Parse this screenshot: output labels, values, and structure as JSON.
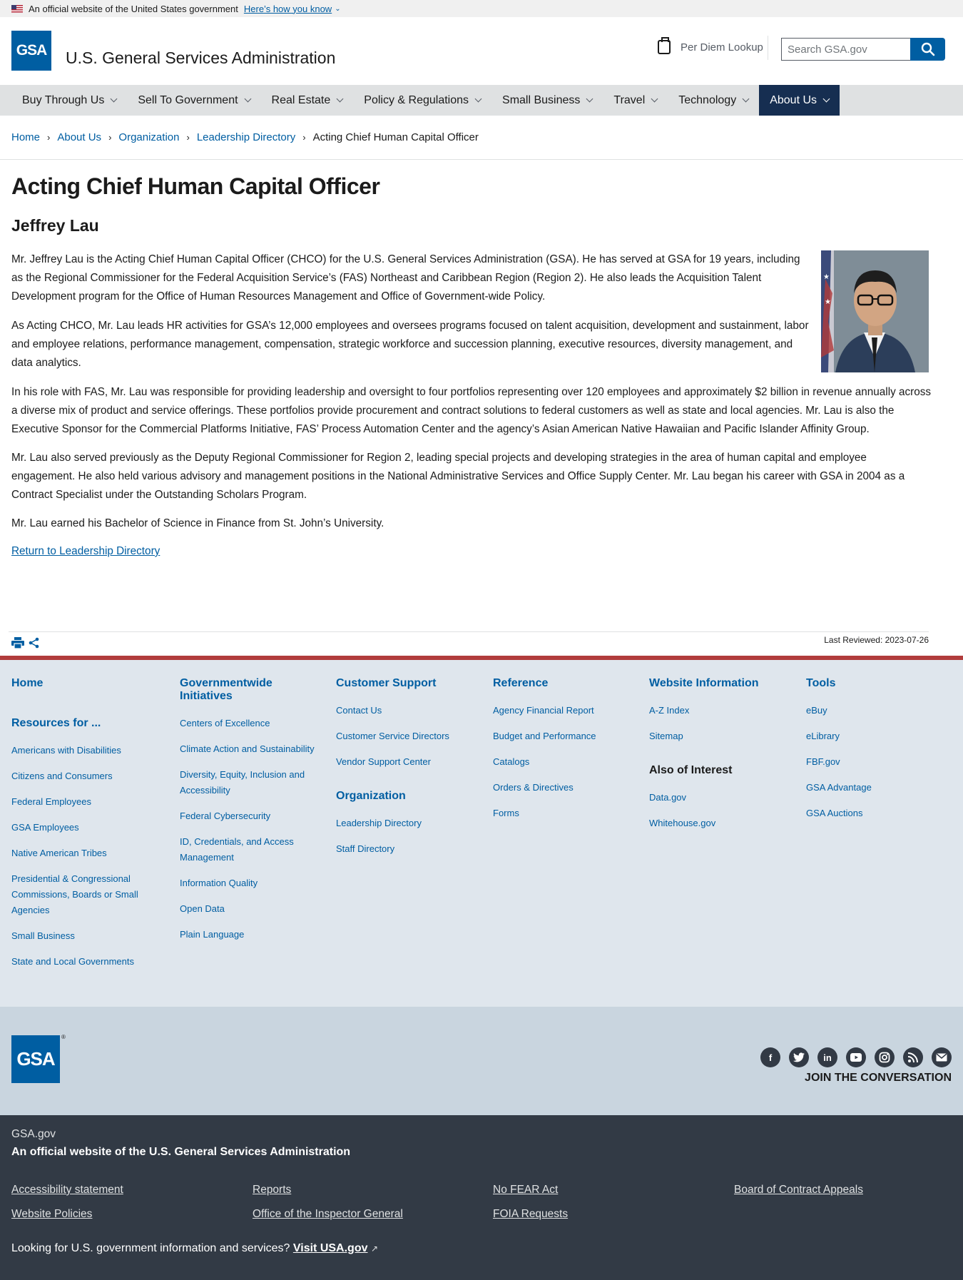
{
  "banner": {
    "text": "An official website of the United States government",
    "how_link": "Here’s how you know"
  },
  "header": {
    "logo_text": "GSA",
    "site_title": "U.S. General Services Administration",
    "per_diem": "Per Diem Lookup",
    "search_placeholder": "Search GSA.gov"
  },
  "nav": {
    "items": [
      {
        "label": "Buy Through Us"
      },
      {
        "label": "Sell To Government"
      },
      {
        "label": "Real Estate"
      },
      {
        "label": "Policy & Regulations"
      },
      {
        "label": "Small Business"
      },
      {
        "label": "Travel"
      },
      {
        "label": "Technology"
      },
      {
        "label": "About Us"
      }
    ],
    "active_color": "#162e51"
  },
  "breadcrumb": {
    "items": [
      "Home",
      "About Us",
      "Organization",
      "Leadership Directory"
    ],
    "current": "Acting Chief Human Capital Officer"
  },
  "main": {
    "title": "Acting Chief Human Capital Officer",
    "name": "Jeffrey Lau",
    "paragraphs": [
      "Mr. Jeffrey Lau is the Acting Chief Human Capital Officer (CHCO) for the U.S. General Services Administration (GSA). He has served at GSA for 19 years, including as the Regional Commissioner for the Federal Acquisition Service’s (FAS) Northeast and Caribbean Region (Region 2). He also leads the Acquisition Talent Development program for the Office of Human Resources Management and Office of Government-wide Policy.",
      "As Acting CHCO, Mr. Lau leads HR activities for GSA’s 12,000 employees and oversees programs focused on talent acquisition, development and sustainment, labor and employee relations, performance management, compensation, strategic workforce and succession planning, executive resources, diversity management, and data analytics.",
      "In his role with FAS, Mr. Lau was responsible for providing leadership and oversight to four portfolios representing over 120 employees and approximately $2 billion in revenue annually across a diverse mix of product and service offerings. These portfolios provide procurement and contract solutions to federal customers as well as state and local agencies. Mr. Lau is also the Executive Sponsor for the Commercial Platforms Initiative, FAS’ Process Automation Center and the agency’s Asian American Native Hawaiian and Pacific Islander Affinity Group.",
      "Mr. Lau also served previously as the Deputy Regional Commissioner for Region 2, leading special projects and developing strategies in the area of human capital and employee engagement. He also held various advisory and management positions in the National Administrative Services and Office Supply Center. Mr. Lau began his career with GSA in 2004 as a Contract Specialist under the Outstanding Scholars Program.",
      "Mr. Lau earned his Bachelor of Science in Finance from St. John’s University."
    ],
    "return_link": "Return to Leadership Directory",
    "last_reviewed": "Last Reviewed: 2023-07-26"
  },
  "footer_nav": {
    "home": "Home",
    "resources_heading": "Resources for ...",
    "resources": [
      "Americans with Disabilities",
      "Citizens and Consumers",
      "Federal Employees",
      "GSA Employees",
      "Native American Tribes",
      "Presidential & Congressional Commissions, Boards or Small Agencies",
      "Small Business",
      "State and Local Governments"
    ],
    "govwide_heading": "Governmentwide Initiatives",
    "govwide": [
      "Centers of Excellence",
      "Climate Action and Sustainability",
      "Diversity, Equity, Inclusion and Accessibility",
      "Federal Cybersecurity",
      "ID, Credentials, and Access Management",
      "Information Quality",
      "Open Data",
      "Plain Language"
    ],
    "customer_heading": "Customer Support",
    "customer": [
      "Contact Us",
      "Customer Service Directors",
      "Vendor Support Center"
    ],
    "org_heading": "Organization",
    "org": [
      "Leadership Directory",
      "Staff Directory"
    ],
    "reference_heading": "Reference",
    "reference": [
      "Agency Financial Report",
      "Budget and Performance",
      "Catalogs",
      "Orders & Directives",
      "Forms"
    ],
    "website_heading": "Website Information",
    "website": [
      "A-Z Index",
      "Sitemap"
    ],
    "interest_heading": "Also of Interest",
    "interest": [
      "Data.gov",
      "Whitehouse.gov"
    ],
    "tools_heading": "Tools",
    "tools": [
      "eBuy",
      "eLibrary",
      "FBF.gov",
      "GSA Advantage",
      "GSA Auctions"
    ]
  },
  "footer_logo": {
    "logo_text": "GSA",
    "registered": "®",
    "social_icons": [
      "facebook-icon",
      "twitter-icon",
      "linkedin-icon",
      "youtube-icon",
      "instagram-icon",
      "blog-icon",
      "email-icon"
    ],
    "join": "JOIN THE CONVERSATION"
  },
  "identifier": {
    "domain": "GSA.gov",
    "official": "An official website of the U.S. General Services Administration",
    "links": [
      "Accessibility statement",
      "Reports",
      "No FEAR Act",
      "Board of Contract Appeals",
      "Website Policies",
      "Office of the Inspector General",
      "FOIA Requests"
    ],
    "usa_text": "Looking for U.S. government information and services?",
    "usa_link": "Visit USA.gov"
  }
}
